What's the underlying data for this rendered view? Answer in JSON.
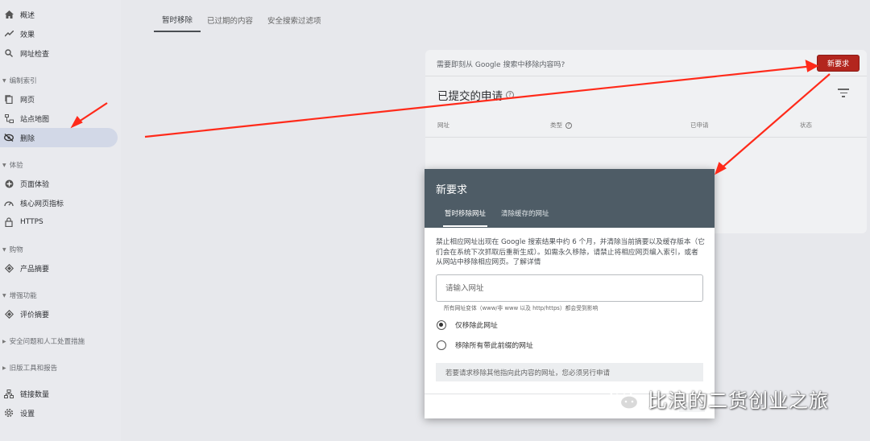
{
  "sidebar": {
    "items": [
      {
        "label": "概述",
        "icon": "home-icon"
      },
      {
        "label": "效果",
        "icon": "trend-icon"
      },
      {
        "label": "网址检查",
        "icon": "search-icon"
      },
      {
        "label": "网页",
        "icon": "page-icon"
      },
      {
        "label": "站点地图",
        "icon": "sitemap-icon"
      },
      {
        "label": "删除",
        "icon": "hide-eye-icon"
      },
      {
        "label": "页面体验",
        "icon": "plus-circle-icon"
      },
      {
        "label": "核心网页指标",
        "icon": "gauge-icon"
      },
      {
        "label": "HTTPS",
        "icon": "lock-icon"
      },
      {
        "label": "产品摘要",
        "icon": "diamond-icon"
      },
      {
        "label": "评价摘要",
        "icon": "diamond-icon"
      },
      {
        "label": "链接数量",
        "icon": "links-icon"
      },
      {
        "label": "设置",
        "icon": "gear-icon"
      }
    ],
    "sections": {
      "index": "编制索引",
      "experience": "体验",
      "shopping": "购物",
      "enhancements": "增强功能",
      "security": "安全问题和人工处置措施",
      "legacy": "旧版工具和报告"
    }
  },
  "tabs": [
    "暂时移除",
    "已过期的内容",
    "安全搜索过滤项"
  ],
  "card": {
    "question": "需要即刻从 Google 搜索中移除内容吗?",
    "new_request_button": "新要求",
    "title": "已提交的申请",
    "columns": [
      "网址",
      "类型",
      "已申请",
      "状态"
    ]
  },
  "modal": {
    "title": "新要求",
    "tabs": [
      "暂时移除网址",
      "清除缓存的网址"
    ],
    "description": "禁止相应网址出现在 Google 搜索结果中约 6 个月，并清除当前摘要以及缓存版本（它们会在系统下次抓取后重新生成）。如需永久移除，请禁止将相应网页编入索引，或者从网站中移除相应网页。",
    "learn_more": "了解详情",
    "input_placeholder": "请输入网址",
    "helper_text": "所有网址变体（www/非 www 以及 http/https）都会受到影响",
    "radio_options": [
      "仅移除此网址",
      "移除所有带此前缀的网址"
    ],
    "selected_option": "仅移除此网址",
    "note": "若要请求移除其他指向此内容的网址，您必须另行申请"
  },
  "watermark": {
    "text": "比浪的二货创业之旅"
  },
  "colors": {
    "accent_red": "#b3261e",
    "modal_header": "#4e5c66",
    "arrow_red": "#ff2a1a"
  }
}
